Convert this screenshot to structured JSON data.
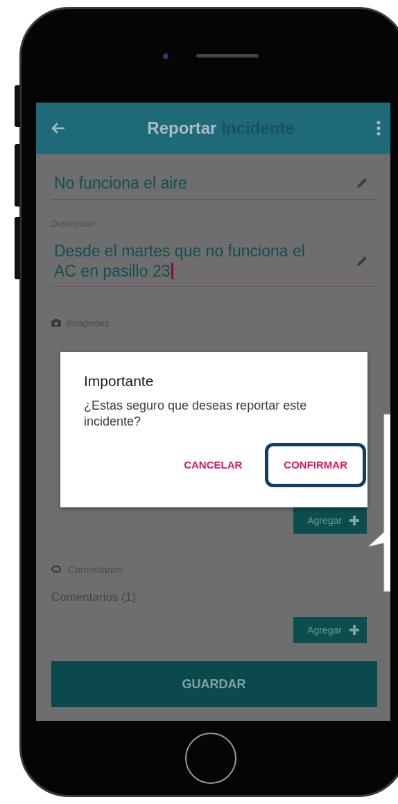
{
  "app_bar": {
    "title_first": "Reportar",
    "title_second": "Incidente"
  },
  "fields": [
    {
      "value": "No funciona el aire",
      "focused": false
    },
    {
      "label": "Descripción",
      "value": "Desde el martes que no funciona el AC en pasillo 23",
      "focused": true
    }
  ],
  "sections": [
    {
      "kind": "images",
      "title": "Imágenes",
      "button": "Agregar"
    },
    {
      "kind": "comments",
      "title": "Comentarios",
      "count": "Comentarios (1)",
      "button": "Agregar"
    }
  ],
  "save_button": "GUARDAR",
  "dialog": {
    "title": "Importante",
    "message": "¿Estas seguro que deseas reportar este incidente?",
    "buttons": [
      {
        "label": "CANCELAR",
        "highlighted": false
      },
      {
        "label": "CONFIRMAR",
        "highlighted": true
      }
    ]
  }
}
